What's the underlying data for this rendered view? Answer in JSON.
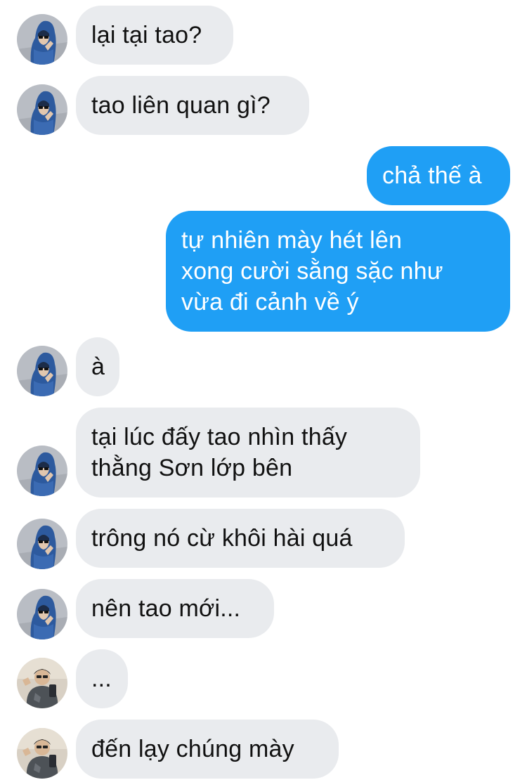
{
  "colors": {
    "incoming_bubble": "#e9ebee",
    "outgoing_bubble": "#1f9ff5",
    "incoming_text": "#111111",
    "outgoing_text": "#ffffff"
  },
  "avatars": {
    "friend_a": "avatar-hooded-blue-jacket",
    "friend_b": "avatar-mirror-selfie"
  },
  "messages": [
    {
      "side": "incoming",
      "sender": "friend_a",
      "text": "lại tại tao?"
    },
    {
      "side": "incoming",
      "sender": "friend_a",
      "text": "tao liên quan gì?"
    },
    {
      "side": "outgoing",
      "text": "chả thế à"
    },
    {
      "side": "outgoing",
      "text": "tự nhiên mày hét lên\nxong cười sằng sặc như\nvừa đi cảnh về ý"
    },
    {
      "side": "incoming",
      "sender": "friend_a",
      "text": "à"
    },
    {
      "side": "incoming",
      "sender": "friend_a",
      "text": "tại lúc đấy tao nhìn thấy\nthằng Sơn lớp bên"
    },
    {
      "side": "incoming",
      "sender": "friend_a",
      "text": "trông nó cừ khôi hài quá"
    },
    {
      "side": "incoming",
      "sender": "friend_a",
      "text": "nên tao mới..."
    },
    {
      "side": "incoming",
      "sender": "friend_b",
      "text": "..."
    },
    {
      "side": "incoming",
      "sender": "friend_b",
      "text": "đến lạy chúng mày"
    }
  ]
}
